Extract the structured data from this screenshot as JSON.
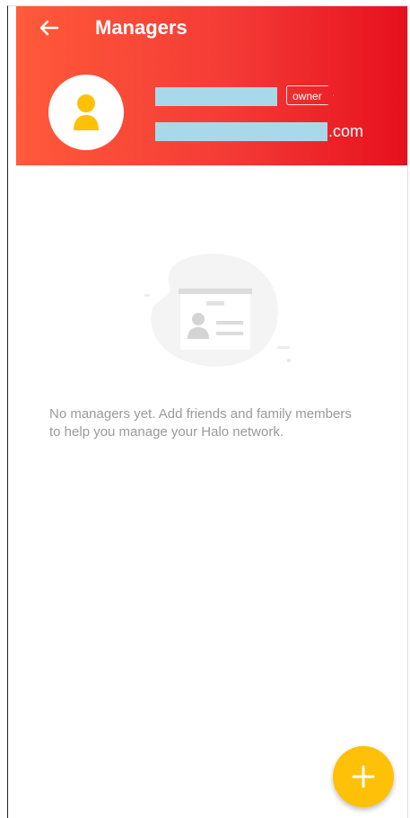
{
  "app_bar": {
    "title": "Managers",
    "back_icon": "arrow-back-icon"
  },
  "owner": {
    "avatar_icon": "person-icon",
    "badge_label": "owner",
    "email_suffix": ".com"
  },
  "empty_state": {
    "illustration_icon": "contact-card-icon",
    "message": "No managers yet. Add friends and family members to help you manage your Halo network."
  },
  "fab": {
    "icon": "plus-icon"
  },
  "colors": {
    "header_start": "#ff5a3a",
    "header_end": "#e6101e",
    "accent": "#ffc107",
    "redaction": "#a7d9ea"
  }
}
